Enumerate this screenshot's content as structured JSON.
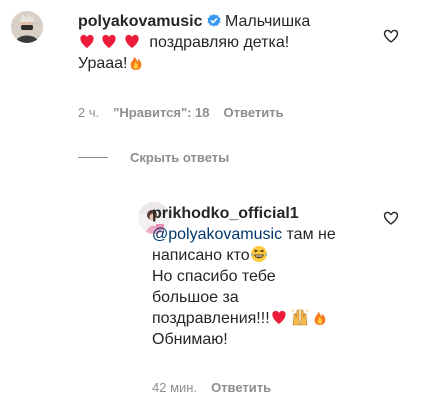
{
  "comment": {
    "username": "polyakovamusic",
    "verified": true,
    "text_part1": "Мальчишка",
    "text_part2": "поздравляю детка!",
    "text_part3": "Урааа!",
    "meta": {
      "time": "2 ч.",
      "likes": "\"Нравится\": 18",
      "reply": "Ответить"
    }
  },
  "hide_replies": {
    "label": "Скрыть ответы"
  },
  "reply": {
    "username": "prikhodko_official1",
    "mention": "@polyakovamusic",
    "line1_rest": " там не",
    "line2": "написано кто",
    "line3": "Но спасибо тебе",
    "line4": "большое за",
    "line5": "поздравления!!!",
    "line6": "Обнимаю!",
    "meta": {
      "time": "42 мин.",
      "reply": "Ответить"
    }
  },
  "colors": {
    "text": "#262626",
    "meta": "#8e8e8e",
    "mention": "#00376b",
    "verified": "#3897f0",
    "heart": "#ed1c3a",
    "fire": "#f47b1f"
  }
}
